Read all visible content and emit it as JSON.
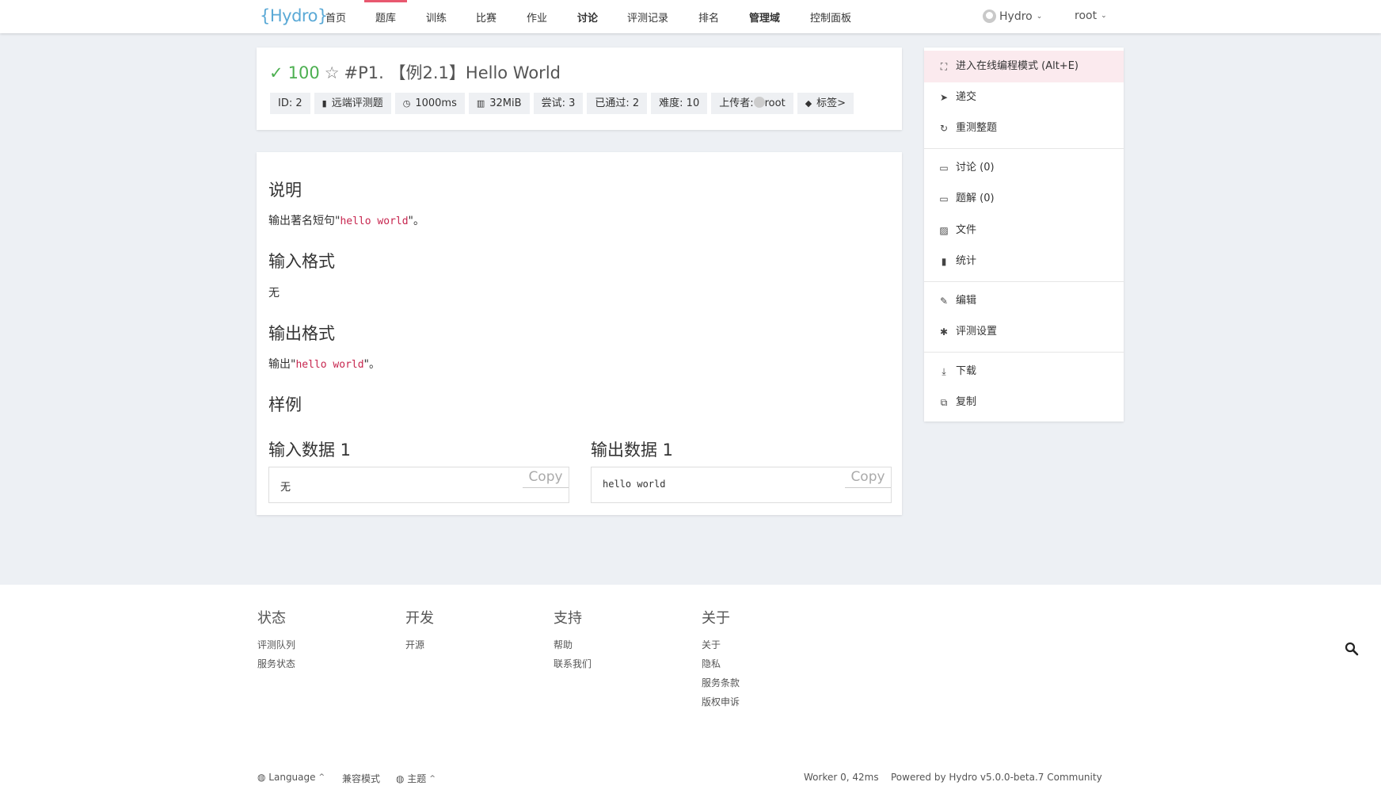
{
  "nav": {
    "logo": "{Hydro}",
    "items": [
      "首页",
      "题库",
      "训练",
      "比赛",
      "作业",
      "讨论",
      "评测记录",
      "排名",
      "管理域",
      "控制面板"
    ],
    "domain_user": "Hydro",
    "user": "root"
  },
  "problem": {
    "status_icon": "check-icon",
    "score": "100",
    "title": "#P1. 【例2.1】Hello World",
    "badges": {
      "id": "ID: 2",
      "type": "远端评测题",
      "time": "1000ms",
      "memory": "32MiB",
      "tried": "尝试: 3",
      "passed": "已通过: 2",
      "difficulty": "难度: 10",
      "uploader_label": "上传者:",
      "uploader": "root",
      "tags": "标签>"
    }
  },
  "content": {
    "desc_title": "说明",
    "desc_prefix": "输出著名短句\"",
    "desc_code": "hello world",
    "desc_suffix": "\"。",
    "input_title": "输入格式",
    "input_text": "无",
    "output_title": "输出格式",
    "output_prefix": "输出\"",
    "output_code": "hello world",
    "output_suffix": "\"。",
    "sample_title": "样例",
    "sample_input_title": "输入数据 1",
    "sample_input": "无",
    "sample_output_title": "输出数据 1",
    "sample_output": "hello world",
    "copy": "Copy"
  },
  "sidebar": {
    "items": [
      {
        "label": "进入在线编程模式 (Alt+E)",
        "icon": "fullscreen-icon"
      },
      {
        "label": "递交",
        "icon": "send-icon"
      },
      {
        "label": "重测整题",
        "icon": "refresh-icon"
      },
      {
        "label": "讨论 (0)",
        "icon": "comment-icon"
      },
      {
        "label": "题解 (0)",
        "icon": "solution-icon"
      },
      {
        "label": "文件",
        "icon": "file-image-icon"
      },
      {
        "label": "统计",
        "icon": "bar-chart-icon"
      },
      {
        "label": "编辑",
        "icon": "pencil-icon"
      },
      {
        "label": "评测设置",
        "icon": "gear-icon"
      },
      {
        "label": "下载",
        "icon": "download-icon"
      },
      {
        "label": "复制",
        "icon": "copy-icon"
      }
    ]
  },
  "footer": {
    "cols": [
      {
        "title": "状态",
        "links": [
          "评测队列",
          "服务状态"
        ]
      },
      {
        "title": "开发",
        "links": [
          "开源"
        ]
      },
      {
        "title": "支持",
        "links": [
          "帮助",
          "联系我们"
        ]
      },
      {
        "title": "关于",
        "links": [
          "关于",
          "隐私",
          "服务条款",
          "版权申诉"
        ]
      }
    ],
    "language": "Language",
    "compat": "兼容模式",
    "theme": "主题",
    "worker": "Worker 0, 42ms",
    "powered": "Powered by Hydro v5.0.0-beta.7 Community"
  },
  "colors": {
    "accent": "#e8586f",
    "success": "#4caf50",
    "highlight": "#fbeaee",
    "background": "#edf0f4"
  }
}
